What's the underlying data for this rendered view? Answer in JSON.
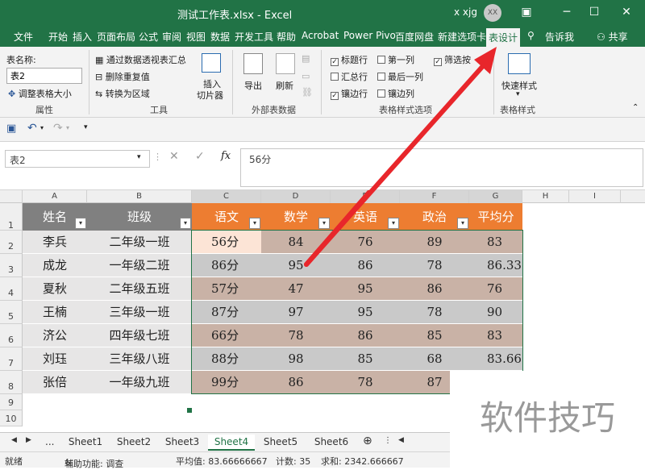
{
  "window": {
    "title": "测试工作表.xlsx  -  Excel",
    "user": "x xjg",
    "avatar_initials": "XX"
  },
  "ribbon_tabs": [
    "文件",
    "开始",
    "插入",
    "页面布局",
    "公式",
    "审阅",
    "视图",
    "数据",
    "开发工具",
    "帮助",
    "Acrobat",
    "Power Pivo",
    "百度网盘",
    "新建选项卡",
    "表设计"
  ],
  "ribbon_extra": {
    "tell_me": "告诉我",
    "share": "共享"
  },
  "ribbon": {
    "properties": {
      "table_name_label": "表名称:",
      "table_name_value": "表2",
      "resize_label": "调整表格大小",
      "group_label": "属性"
    },
    "tools": {
      "pivot_label": "通过数据透视表汇总",
      "remove_dup_label": "删除重复值",
      "convert_label": "转换为区域",
      "slicer_label_1": "插入",
      "slicer_label_2": "切片器",
      "group_label": "工具"
    },
    "external": {
      "export_label": "导出",
      "refresh_label": "刷新",
      "group_label": "外部表数据"
    },
    "style_options": {
      "header_row": "标题行",
      "first_col": "第一列",
      "filter_btn": "筛选按",
      "total_row": "汇总行",
      "last_col": "最后一列",
      "banded_rows": "镶边行",
      "banded_cols": "镶边列",
      "group_label": "表格样式选项"
    },
    "styles": {
      "quick_label": "快速样式",
      "group_label": "表格样式"
    }
  },
  "formula_bar": {
    "name_box": "表2",
    "fx": "fx",
    "content": "56分"
  },
  "columns": [
    "A",
    "B",
    "C",
    "D",
    "E",
    "F",
    "G",
    "H",
    "I"
  ],
  "rows": [
    "1",
    "2",
    "3",
    "4",
    "5",
    "6",
    "7",
    "8",
    "9",
    "10"
  ],
  "table": {
    "headers": [
      "姓名",
      "班级",
      "语文",
      "数学",
      "英语",
      "政治",
      "平均分"
    ],
    "data": [
      [
        "李兵",
        "二年级一班",
        "56分",
        "84",
        "76",
        "89",
        "83"
      ],
      [
        "成龙",
        "一年级二班",
        "86分",
        "95",
        "86",
        "78",
        "86.333"
      ],
      [
        "夏秋",
        "二年级五班",
        "57分",
        "47",
        "95",
        "86",
        "76"
      ],
      [
        "王楠",
        "三年级一班",
        "87分",
        "97",
        "95",
        "78",
        "90"
      ],
      [
        "济公",
        "四年级七班",
        "66分",
        "78",
        "86",
        "85",
        "83"
      ],
      [
        "刘珏",
        "三年级八班",
        "88分",
        "98",
        "85",
        "68",
        "83.667"
      ],
      [
        "张倍",
        "一年级九班",
        "99分",
        "86",
        "78",
        "87",
        ""
      ]
    ]
  },
  "sheet_tabs": [
    "Sheet1",
    "Sheet2",
    "Sheet3",
    "Sheet4",
    "Sheet5",
    "Sheet6"
  ],
  "active_sheet": "Sheet4",
  "sheet_nav_more": "...",
  "status": {
    "mode": "就绪",
    "accessibility": "辅助功能: 调查",
    "average": "平均值: 83.66666667",
    "count": "计数: 35",
    "sum": "求和: 2342.666667"
  },
  "watermark": "软件技巧",
  "colors": {
    "excel_green": "#217346",
    "header_orange": "#ED7D31",
    "band_tan": "#C9B2A6",
    "band_gray": "#C9C9C9",
    "header_gray": "#808080",
    "selected_cell": "#FCE4D6",
    "arrow_red": "#E8262B"
  }
}
